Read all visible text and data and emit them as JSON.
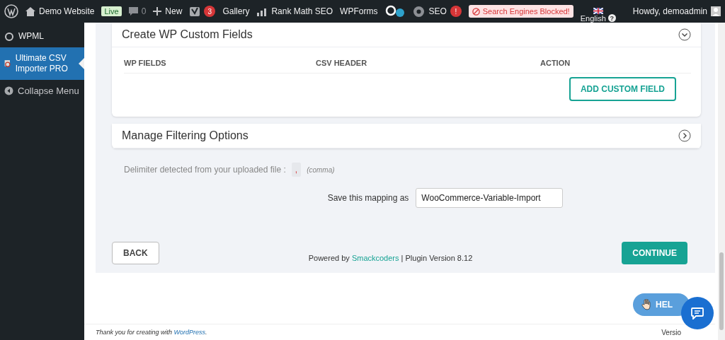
{
  "admin_bar": {
    "site": "Demo Website",
    "live": "Live",
    "comments": "0",
    "new": "New",
    "yoast_count": "3",
    "gallery": "Gallery",
    "rank_math": "Rank Math SEO",
    "wpforms": "WPForms",
    "seo": "SEO",
    "seo_alert": "!",
    "blocked": "Search Engines Blocked!",
    "language": "English",
    "language_help": "?",
    "howdy": "Howdy, demoadmin"
  },
  "sidebar": {
    "items": [
      {
        "label": "WPML",
        "selected": false
      },
      {
        "label": "Ultimate CSV Importer PRO",
        "selected": true
      },
      {
        "label": "Collapse Menu",
        "selected": false
      }
    ]
  },
  "panels": [
    {
      "title": "Create WP Custom Fields",
      "expanded": true,
      "columns": [
        "WP FIELDS",
        "CSV HEADER",
        "ACTION"
      ],
      "button": "ADD CUSTOM FIELD"
    },
    {
      "title": "Manage Filtering Options",
      "expanded": false
    }
  ],
  "delimiter": {
    "label": "Delimiter detected from your uploaded file :",
    "value": ",",
    "note": "(comma)"
  },
  "mapping": {
    "label": "Save this mapping as",
    "value": "WooCommerce-Variable-Import"
  },
  "footer_row": {
    "back": "BACK",
    "powered_prefix": "Powered by",
    "powered_link": "Smackcoders",
    "powered_suffix": "| Plugin Version 8.12",
    "continue": "CONTINUE"
  },
  "help": "HEL",
  "wp_footer": {
    "prefix": "Thank you for creating with",
    "link": "WordPress",
    "suffix": ".",
    "version": "Versio"
  }
}
